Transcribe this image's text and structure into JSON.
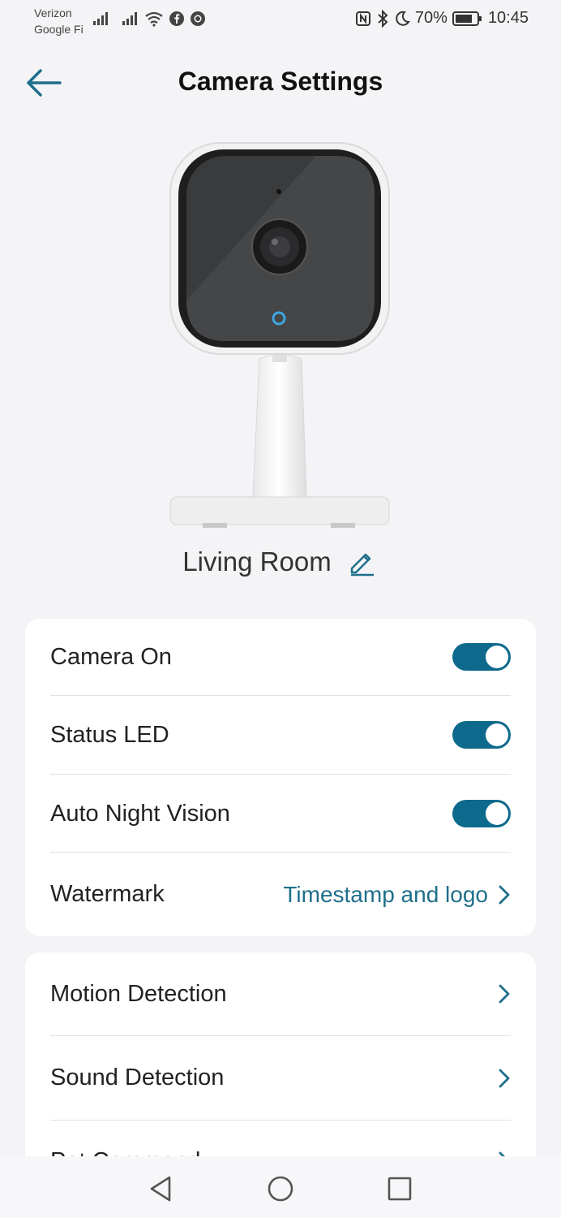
{
  "status_bar": {
    "carrier_line1": "Verizon",
    "carrier_line2": "Google Fi",
    "battery_percent": "70%",
    "time": "10:45"
  },
  "header": {
    "title": "Camera Settings",
    "back_icon": "arrow-left-icon"
  },
  "device": {
    "name": "Living Room",
    "edit_icon": "pencil-icon"
  },
  "settings_card": {
    "rows": [
      {
        "label": "Camera On",
        "toggle_on": true
      },
      {
        "label": "Status LED",
        "toggle_on": true
      },
      {
        "label": "Auto Night Vision",
        "toggle_on": true
      },
      {
        "label": "Watermark",
        "value": "Timestamp and logo"
      }
    ]
  },
  "detection_card": {
    "rows": [
      {
        "label": "Motion Detection"
      },
      {
        "label": "Sound Detection"
      },
      {
        "label": "Pet Command"
      }
    ]
  },
  "colors": {
    "accent": "#0e6a8c",
    "link": "#1f6f8b",
    "background": "#f4f4f7"
  },
  "nav_bar": {
    "back_icon": "triangle-back-icon",
    "home_icon": "circle-home-icon",
    "recents_icon": "square-recents-icon"
  }
}
